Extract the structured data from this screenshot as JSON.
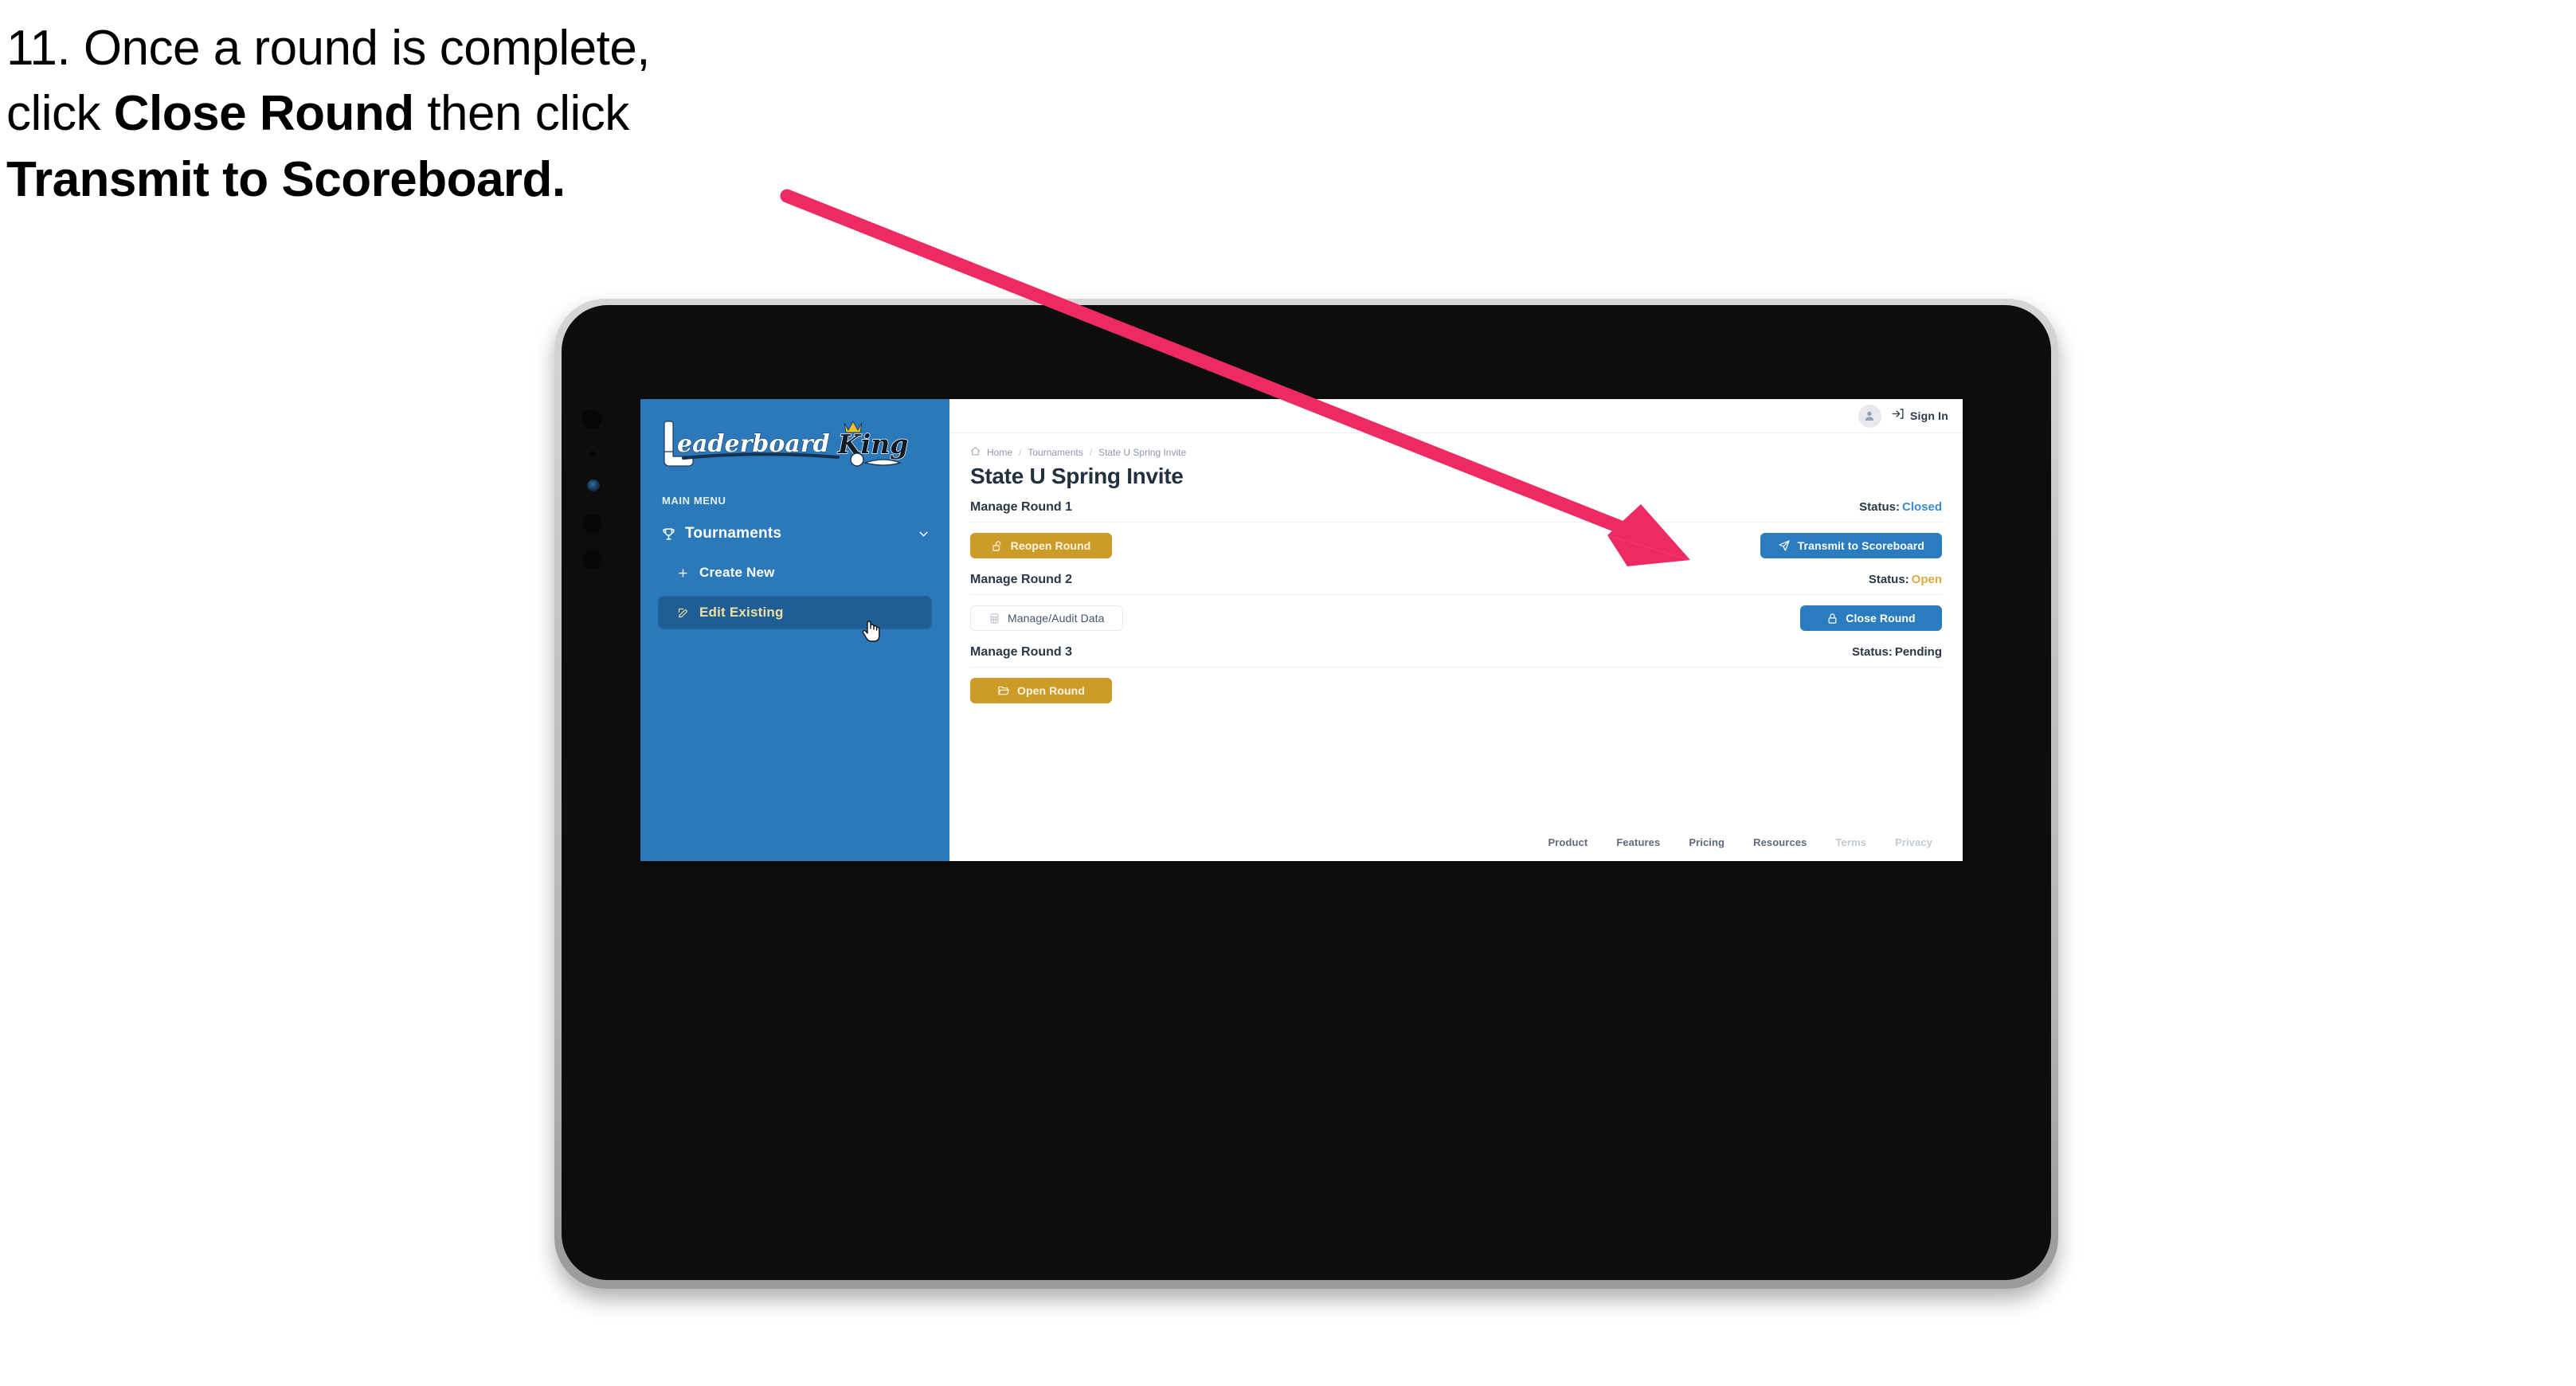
{
  "caption": {
    "line1_plain": "11. Once a round is complete,",
    "line2_pre": "click ",
    "line2_bold": "Close Round",
    "line2_post": " then click",
    "line3_bold": "Transmit to Scoreboard."
  },
  "colors": {
    "sidebar_blue": "#2B79BB",
    "sidebar_active_blue": "#1F5E94",
    "sidebar_active_text": "#F0DFA2",
    "gold": "#CD9B28",
    "blue_button": "#2A7CBF",
    "status_closed": "#3A8CD4",
    "status_open": "#E0A93D",
    "status_pending": "#2A3746",
    "arrow_pink": "#ED2A63",
    "screen_bg": "#FFFFFF",
    "tablet_bezel": "#0D0D0D",
    "tablet_frame": "#C3C3C3"
  },
  "sidebar": {
    "logo_text": "LeaderboardKing",
    "logo_word1": "Leaderboard",
    "logo_word2": "King",
    "section_label": "MAIN MENU",
    "nav": {
      "label": "Tournaments",
      "icon": "trophy-icon",
      "chevron": "chevron-down-icon"
    },
    "sub_items": [
      {
        "label": "Create New",
        "icon": "plus-icon",
        "active": false
      },
      {
        "label": "Edit Existing",
        "icon": "edit-pencil-icon",
        "active": true
      }
    ]
  },
  "topbar": {
    "avatar_icon": "user-avatar-icon",
    "signin_icon": "login-arrow-icon",
    "signin_label": "Sign In"
  },
  "breadcrumb": {
    "home_icon": "home-icon",
    "items": [
      "Home",
      "Tournaments",
      "State U Spring Invite"
    ],
    "separator": "/"
  },
  "page": {
    "title": "State U Spring Invite"
  },
  "rounds": [
    {
      "title": "Manage Round 1",
      "status_label": "Status:",
      "status_value": "Closed",
      "status_kind": "closed",
      "left_button": {
        "label": "Reopen Round",
        "icon": "unlock-icon",
        "style": "gold"
      },
      "right_button": {
        "label": "Transmit to Scoreboard",
        "icon": "paper-plane-icon",
        "style": "blue"
      }
    },
    {
      "title": "Manage Round 2",
      "status_label": "Status:",
      "status_value": "Open",
      "status_kind": "open",
      "left_button": {
        "label": "Manage/Audit Data",
        "icon": "table-grid-icon",
        "style": "ghost"
      },
      "right_button": {
        "label": "Close Round",
        "icon": "lock-icon",
        "style": "blue"
      }
    },
    {
      "title": "Manage Round 3",
      "status_label": "Status:",
      "status_value": "Pending",
      "status_kind": "pending",
      "left_button": {
        "label": "Open Round",
        "icon": "folder-open-icon",
        "style": "gold"
      },
      "right_button": null
    }
  ],
  "footer": {
    "links": [
      {
        "label": "Product",
        "muted": false
      },
      {
        "label": "Features",
        "muted": false
      },
      {
        "label": "Pricing",
        "muted": false
      },
      {
        "label": "Resources",
        "muted": false
      },
      {
        "label": "Terms",
        "muted": true
      },
      {
        "label": "Privacy",
        "muted": true
      }
    ]
  },
  "cursor": {
    "icon": "pointing-hand-cursor"
  }
}
